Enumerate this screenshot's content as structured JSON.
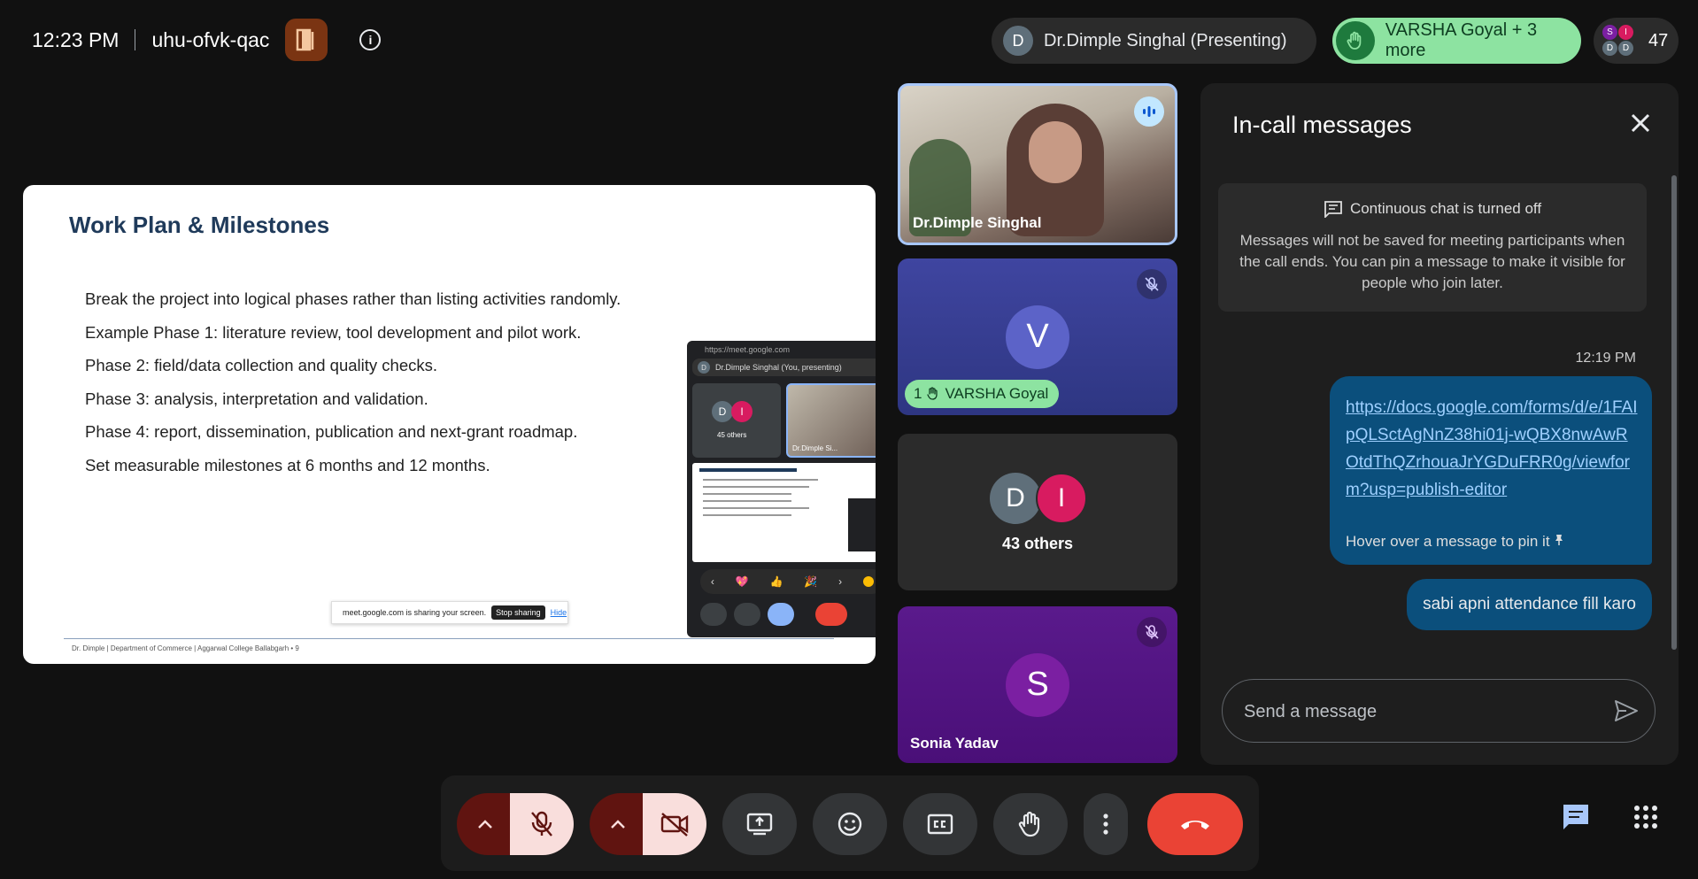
{
  "header": {
    "time": "12:23 PM",
    "meeting_code": "uhu-ofvk-qac",
    "presenter_initial": "D",
    "presenter_label": "Dr.Dimple Singhal (Presenting)",
    "raised_hands_label": "VARSHA Goyal + 3 more",
    "participant_count": "47",
    "mini_avatars": [
      "S",
      "I",
      "D",
      "D"
    ]
  },
  "slide": {
    "title": "Work Plan & Milestones",
    "bullets": [
      "Break the project into logical phases rather than listing activities randomly.",
      "Example Phase 1: literature review, tool development and pilot work.",
      "Phase 2: field/data collection and quality checks.",
      "Phase 3: analysis, interpretation and validation.",
      "Phase 4: report, dissemination, publication and next-grant roadmap.",
      "Set measurable milestones at 6 months and 12 months."
    ],
    "footer": "Dr. Dimple | Department of Commerce | Aggarwal College Ballabgarh   •   9",
    "sharing_text": "meet.google.com is sharing your screen.",
    "stop_sharing": "Stop sharing",
    "hide": "Hide"
  },
  "mini_window": {
    "url": "https://meet.google.com",
    "presenter": "Dr.Dimple Singhal (You, presenting)",
    "others": "45 others",
    "self_name": "Dr.Dimple Si...",
    "avatar_d": "D",
    "avatar_i": "I",
    "reactions": [
      "‹",
      "💖",
      "👍",
      "🎉",
      "›"
    ]
  },
  "tiles": {
    "dimple_name": "Dr.Dimple Singhal",
    "varsha_initial": "V",
    "varsha_hand_count": "1",
    "varsha_name": "VARSHA Goyal",
    "others_d": "D",
    "others_i": "I",
    "others_label": "43 others",
    "sonia_initial": "S",
    "sonia_name": "Sonia Yadav"
  },
  "chat": {
    "title": "In-call messages",
    "notice_title": "Continuous chat is turned off",
    "notice_body": "Messages will not be saved for meeting participants when the call ends. You can pin a message to make it visible for people who join later.",
    "time": "12:19 PM",
    "link": "https://docs.google.com/forms/d/e/1FAIpQLSctAgNnZ38hi01j-wQBX8nwAwROtdThQZrhouaJrYGDuFRR0g/viewform?usp=publish-editor",
    "pin_hint": "Hover over a message to pin it",
    "message2": "sabi apni attendance fill karo",
    "placeholder": "Send a message"
  },
  "colors": {
    "background": "#111111",
    "accent_blue": "#0b4f7c",
    "end_call": "#ea4335",
    "muted": "#f9dedc",
    "hand_green": "#8de3a1"
  }
}
